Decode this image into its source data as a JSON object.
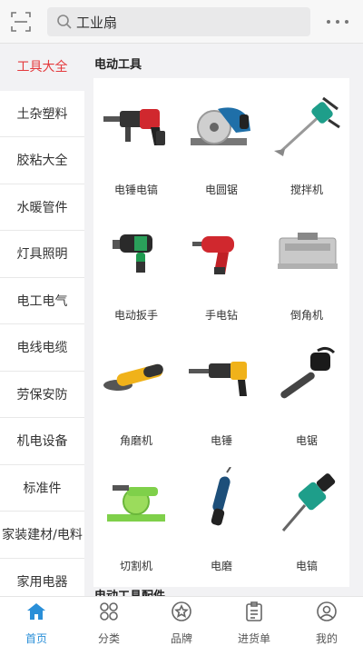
{
  "header": {
    "search_text": "工业扇"
  },
  "sidebar": {
    "items": [
      {
        "label": "工具大全",
        "active": true
      },
      {
        "label": "土杂塑料"
      },
      {
        "label": "胶粘大全"
      },
      {
        "label": "水暖管件"
      },
      {
        "label": "灯具照明"
      },
      {
        "label": "电工电气"
      },
      {
        "label": "电线电缆"
      },
      {
        "label": "劳保安防"
      },
      {
        "label": "机电设备"
      },
      {
        "label": "标准件"
      },
      {
        "label": "家装建材/电料"
      },
      {
        "label": "家用电器"
      }
    ]
  },
  "main": {
    "section_title": "电动工具",
    "products": [
      {
        "label": "电锤电镐",
        "icon": "rotary-hammer-icon"
      },
      {
        "label": "电圆锯",
        "icon": "circular-saw-icon"
      },
      {
        "label": "搅拌机",
        "icon": "mixer-icon"
      },
      {
        "label": "电动扳手",
        "icon": "impact-wrench-icon"
      },
      {
        "label": "手电钻",
        "icon": "hand-drill-icon"
      },
      {
        "label": "倒角机",
        "icon": "chamfering-machine-icon"
      },
      {
        "label": "角磨机",
        "icon": "angle-grinder-icon"
      },
      {
        "label": "电锤",
        "icon": "electric-hammer-icon"
      },
      {
        "label": "电锯",
        "icon": "chainsaw-icon"
      },
      {
        "label": "切割机",
        "icon": "cutoff-machine-icon"
      },
      {
        "label": "电磨",
        "icon": "die-grinder-icon"
      },
      {
        "label": "电镐",
        "icon": "demolition-hammer-icon"
      }
    ],
    "section_title_2": "电动工具配件"
  },
  "bottom_nav": {
    "items": [
      {
        "label": "首页",
        "icon": "home-icon",
        "active": true
      },
      {
        "label": "分类",
        "icon": "category-icon"
      },
      {
        "label": "品牌",
        "icon": "brand-star-icon"
      },
      {
        "label": "进货单",
        "icon": "order-list-icon"
      },
      {
        "label": "我的",
        "icon": "profile-icon"
      }
    ]
  },
  "colors": {
    "accent_red": "#e4393c",
    "accent_blue": "#2a8fd8"
  }
}
